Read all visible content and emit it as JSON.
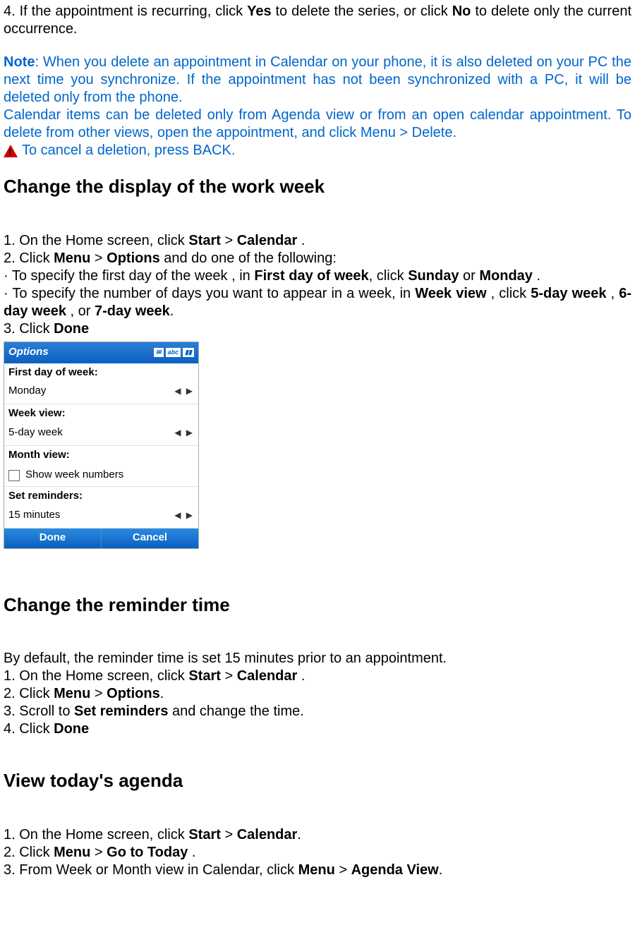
{
  "intro": {
    "step4_pre": "4. If the appointment is recurring, click ",
    "yes": "Yes",
    "step4_mid": " to delete the series, or click ",
    "no": "No",
    "step4_post": " to delete only the current occurrence."
  },
  "note": {
    "label": "Note",
    "text1": ": When you delete an appointment in Calendar on your phone, it is also deleted on your PC the next time you synchronize. If the appointment has not been synchronized with a PC, it will be deleted only from the phone.",
    "text2": "Calendar items can be deleted only from Agenda view or from an open calendar appointment. To delete from other views, open the appointment, and click Menu > Delete.",
    "cancel": "To cancel a deletion, press BACK."
  },
  "section1": {
    "title": "Change the display of the work week",
    "step1_pre": "1. On the Home screen, click ",
    "start": "Start",
    "gt": " > ",
    "calendar": "Calendar",
    "step1_post": " .",
    "step2_pre": "2. Click ",
    "menu": "Menu",
    "options": "Options",
    "step2_post": " and do one of the following:",
    "bullet1_pre": "· To specify the first day of the week , in ",
    "firstday": "First day of week",
    "bullet1_mid": ", click ",
    "sunday": "Sunday",
    "or": " or ",
    "monday": "Monday",
    "bullet1_post": " .",
    "bullet2_pre": "· To specify the number of days you want to appear in a week, in ",
    "weekview": "Week view",
    "bullet2_mid": " , click ",
    "fiveday": "5-day week",
    "sixday": "6-day week",
    "sevenday": "7-day week",
    "comma_or": " , or ",
    "period": ".",
    "step3_pre": "3. Click ",
    "done": "Done"
  },
  "phone": {
    "title": "Options",
    "status_abc": "abc",
    "label_firstday": "First day of week:",
    "value_firstday": "Monday",
    "label_weekview": "Week view:",
    "value_weekview": "5-day week",
    "label_monthview": "Month view:",
    "checkbox_label": "Show week numbers",
    "label_reminders": "Set reminders:",
    "value_reminders": "15 minutes",
    "softkey_done": "Done",
    "softkey_cancel": "Cancel"
  },
  "section2": {
    "title": "Change the reminder time",
    "intro": "By default, the reminder time is set 15 minutes prior to an appointment.",
    "step1_pre": "1. On the Home screen, click ",
    "start": "Start",
    "gt": " > ",
    "calendar": "Calendar",
    "step1_post": " .",
    "step2_pre": "2. Click ",
    "menu": "Menu",
    "options": "Options",
    "step2_post": ".",
    "step3_pre": "3. Scroll to ",
    "setreminders": "Set reminders",
    "step3_post": " and change the time.",
    "step4_pre": "4. Click ",
    "done": "Done"
  },
  "section3": {
    "title": "View today's agenda",
    "step1_pre": "1. On the Home screen, click ",
    "start": "Start",
    "gt": " > ",
    "calendar": "Calendar",
    "step1_post": ".",
    "step2_pre": "2. Click ",
    "menu": "Menu",
    "gototoday": "Go to Today",
    "step2_post": " .",
    "step3_pre": "3. From Week or Month view in Calendar, click ",
    "agendaview": "Agenda View",
    "step3_post": "."
  }
}
